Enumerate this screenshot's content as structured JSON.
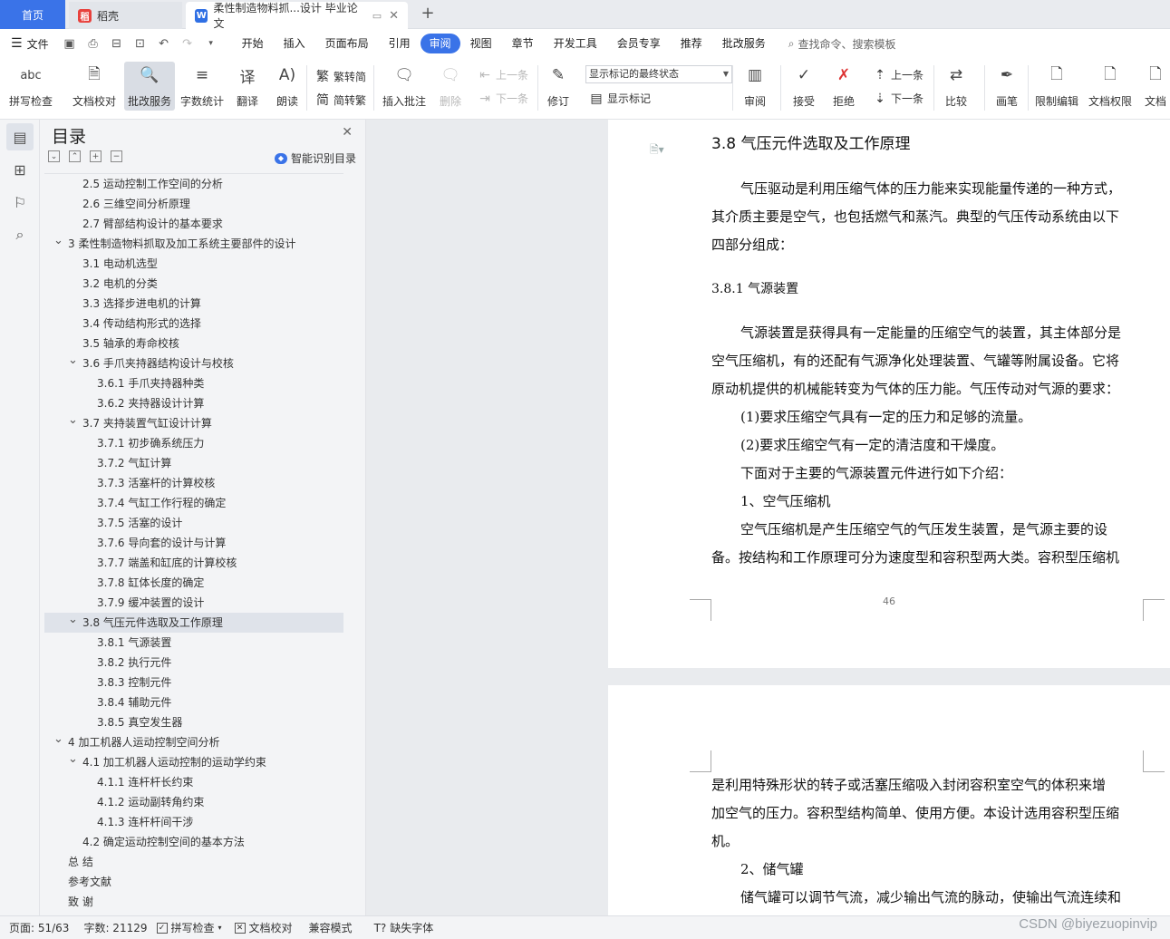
{
  "tabs": {
    "home": "首页",
    "docer": "稻壳",
    "document": "柔性制造物料抓...设计 毕业论文",
    "add": "+"
  },
  "menu": {
    "file": "文件",
    "items": [
      "开始",
      "插入",
      "页面布局",
      "引用",
      "审阅",
      "视图",
      "章节",
      "开发工具",
      "会员专享",
      "推荐",
      "批改服务"
    ],
    "active_index": 4,
    "search": "查找命令、搜索模板"
  },
  "ribbon": {
    "spellcheck": "拼写检查",
    "doc_proofread": "文档校对",
    "correction_service": "批改服务",
    "word_count": "字数统计",
    "translate": "翻译",
    "read_aloud": "朗读",
    "trad_simp": "繁转简",
    "simp_trad": "简转繁",
    "insert_comment": "插入批注",
    "delete": "删除",
    "prev_item": "上一条",
    "next_item": "下一条",
    "track_changes": "修订",
    "markup_state": "显示标记的最终状态",
    "show_markup": "显示标记",
    "review": "审阅",
    "accept": "接受",
    "reject": "拒绝",
    "prev_change": "上一条",
    "next_change": "下一条",
    "compare": "比较",
    "ink": "画笔",
    "restrict_editing": "限制编辑",
    "doc_permissions": "文档权限",
    "doc_more": "文档"
  },
  "toc": {
    "title": "目录",
    "smart": "智能识别目录",
    "items": [
      {
        "text": "2.5  运动控制工作空间的分析",
        "level": 2,
        "arrow": ""
      },
      {
        "text": "2.6 三维空间分析原理",
        "level": 2,
        "arrow": ""
      },
      {
        "text": "2.7 臂部结构设计的基本要求",
        "level": 2,
        "arrow": ""
      },
      {
        "text": "3  柔性制造物料抓取及加工系统主要部件的设计",
        "level": 1,
        "arrow": "v"
      },
      {
        "text": "3.1 电动机选型",
        "level": 2,
        "arrow": ""
      },
      {
        "text": "3.2 电机的分类",
        "level": 2,
        "arrow": ""
      },
      {
        "text": "3.3 选择步进电机的计算",
        "level": 2,
        "arrow": ""
      },
      {
        "text": "3.4 传动结构形式的选择",
        "level": 2,
        "arrow": ""
      },
      {
        "text": "3.5  轴承的寿命校核",
        "level": 2,
        "arrow": ""
      },
      {
        "text": "3.6  手爪夹持器结构设计与校核",
        "level": 2,
        "arrow": "v"
      },
      {
        "text": "3.6.1 手爪夹持器种类",
        "level": 3,
        "arrow": ""
      },
      {
        "text": "3.6.2 夹持器设计计算",
        "level": 3,
        "arrow": ""
      },
      {
        "text": "3.7  夹持装置气缸设计计算",
        "level": 2,
        "arrow": "v"
      },
      {
        "text": "3.7.1  初步确系统压力",
        "level": 3,
        "arrow": ""
      },
      {
        "text": "3.7.2 气缸计算",
        "level": 3,
        "arrow": ""
      },
      {
        "text": "3.7.3  活塞杆的计算校核",
        "level": 3,
        "arrow": ""
      },
      {
        "text": "3.7.4  气缸工作行程的确定",
        "level": 3,
        "arrow": ""
      },
      {
        "text": "3.7.5  活塞的设计",
        "level": 3,
        "arrow": ""
      },
      {
        "text": "3.7.6  导向套的设计与计算",
        "level": 3,
        "arrow": ""
      },
      {
        "text": "3.7.7  端盖和缸底的计算校核",
        "level": 3,
        "arrow": ""
      },
      {
        "text": "3.7.8  缸体长度的确定",
        "level": 3,
        "arrow": ""
      },
      {
        "text": "3.7.9  缓冲装置的设计",
        "level": 3,
        "arrow": ""
      },
      {
        "text": "3.8  气压元件选取及工作原理",
        "level": 2,
        "arrow": "v",
        "selected": true
      },
      {
        "text": "3.8.1  气源装置",
        "level": 3,
        "arrow": ""
      },
      {
        "text": "3.8.2  执行元件",
        "level": 3,
        "arrow": ""
      },
      {
        "text": "3.8.3  控制元件",
        "level": 3,
        "arrow": ""
      },
      {
        "text": "3.8.4  辅助元件",
        "level": 3,
        "arrow": ""
      },
      {
        "text": "3.8.5  真空发生器",
        "level": 3,
        "arrow": ""
      },
      {
        "text": "4  加工机器人运动控制空间分析",
        "level": 1,
        "arrow": "v"
      },
      {
        "text": "4.1 加工机器人运动控制的运动学约束",
        "level": 2,
        "arrow": "v"
      },
      {
        "text": "4.1.1  连杆杆长约束",
        "level": 3,
        "arrow": ""
      },
      {
        "text": "4.1.2  运动副转角约束",
        "level": 3,
        "arrow": ""
      },
      {
        "text": "4.1.3  连杆杆间干涉",
        "level": 3,
        "arrow": ""
      },
      {
        "text": "4.2  确定运动控制空间的基本方法",
        "level": 2,
        "arrow": ""
      },
      {
        "text": "总    结",
        "level": 1,
        "arrow": ""
      },
      {
        "text": "参考文献",
        "level": 1,
        "arrow": ""
      },
      {
        "text": "致    谢",
        "level": 1,
        "arrow": ""
      }
    ]
  },
  "document": {
    "heading": "3.8  气压元件选取及工作原理",
    "page1_lines": [
      {
        "text": "气压驱动是利用压缩气体的压力能来实现能量传递的一种方式，",
        "indent": true
      },
      {
        "text": "其介质主要是空气，也包括燃气和蒸汽。典型的气压传动系统由以下",
        "indent": false
      },
      {
        "text": "四部分组成：",
        "indent": false
      }
    ],
    "subheading": "3.8.1  气源装置",
    "page1_lines2": [
      {
        "text": "气源装置是获得具有一定能量的压缩空气的装置，其主体部分是",
        "indent": true
      },
      {
        "text": "空气压缩机，有的还配有气源净化处理装置、气罐等附属设备。它将",
        "indent": false
      },
      {
        "text": "原动机提供的机械能转变为气体的压力能。气压传动对气源的要求：",
        "indent": false
      },
      {
        "text": "(1)要求压缩空气具有一定的压力和足够的流量。",
        "indent": true
      },
      {
        "text": "(2)要求压缩空气有一定的清洁度和干燥度。",
        "indent": true
      },
      {
        "text": "下面对于主要的气源装置元件进行如下介绍：",
        "indent": true
      },
      {
        "text": "1、空气压缩机",
        "indent": true
      },
      {
        "text": "空气压缩机是产生压缩空气的气压发生装置，是气源主要的设",
        "indent": true
      },
      {
        "text": "备。按结构和工作原理可分为速度型和容积型两大类。容积型压缩机",
        "indent": false
      }
    ],
    "page_number": "46",
    "page2_lines": [
      {
        "text": "是利用特殊形状的转子或活塞压缩吸入封闭容积室空气的体积来增",
        "indent": false
      },
      {
        "text": "加空气的压力。容积型结构简单、使用方便。本设计选用容积型压缩",
        "indent": false
      },
      {
        "text": "机。",
        "indent": false
      },
      {
        "text": "2、储气罐",
        "indent": true
      },
      {
        "text": "储气罐可以调节气流，减少输出气流的脉动，使输出气流连续和",
        "indent": true
      }
    ]
  },
  "status": {
    "page": "页面: 51/63",
    "words": "字数: 21129",
    "spell": "拼写检查",
    "proof": "文档校对",
    "compat": "兼容模式",
    "missing_font": "缺失字体"
  },
  "watermark": "CSDN @biyezuopinvip",
  "colors": {
    "accent": "#3a73e8",
    "panel": "#f3f4f6",
    "page_bg": "#e9ebee"
  }
}
